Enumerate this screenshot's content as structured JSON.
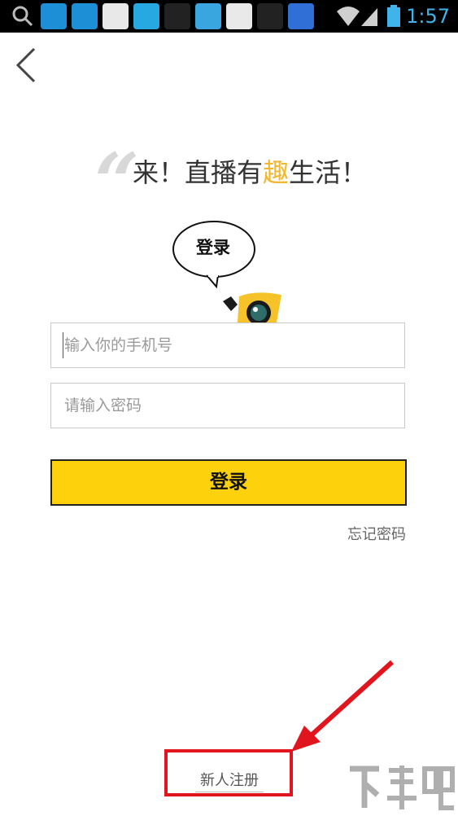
{
  "status_bar": {
    "time": "1:57",
    "icons": [
      "search-icon",
      "app-icon",
      "app-icon",
      "news-icon",
      "qq-icon",
      "app-icon",
      "app-icon",
      "browser-icon",
      "app-icon",
      "baidu-icon",
      "wifi-icon",
      "signal-icon",
      "battery-icon"
    ]
  },
  "slogan": {
    "part1": "来！直播有",
    "highlight": "趣",
    "part2": "生活！"
  },
  "bubble": {
    "label": "登录"
  },
  "form": {
    "phone_placeholder": "输入你的手机号",
    "password_placeholder": "请输入密码",
    "login_label": "登录",
    "forgot_label": "忘记密码"
  },
  "register": {
    "label": "新人注册"
  },
  "colors": {
    "accent": "#fdd10b",
    "highlight_text": "#f0b72f",
    "annotation": "#e0151d",
    "time": "#3fb3ea"
  }
}
